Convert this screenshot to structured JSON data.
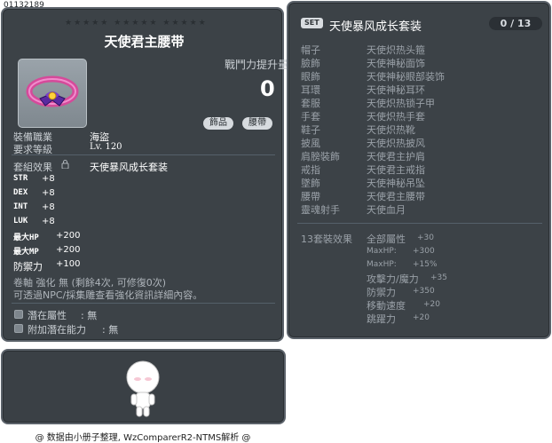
{
  "item": {
    "id_code": "01132189",
    "stars": "★★★★★  ★★★★★  ★★★★★",
    "name": "天使君主腰带",
    "damage_label": "戰鬥力提升量",
    "damage_value": "0",
    "categories": [
      "飾品",
      "腰帶"
    ],
    "job_label": "裝備職業",
    "job_value": "海盜",
    "level_label": "要求等級",
    "level_value": "Lv. 120",
    "set_label": "套組效果",
    "set_name": "天使暴风成长套装",
    "stats": [
      {
        "name": "STR",
        "value": "+8"
      },
      {
        "name": "DEX",
        "value": "+8"
      },
      {
        "name": "INT",
        "value": "+8"
      },
      {
        "name": "LUK",
        "value": "+8"
      },
      {
        "name": "最大HP",
        "value": "+200"
      },
      {
        "name": "最大MP",
        "value": "+200"
      },
      {
        "name": "防禦力",
        "value": "+100"
      }
    ],
    "upgrade_text": "卷軸 強化 無 (剩餘4次, 可修復0次)",
    "info_text": "可透過NPC/採集雕查看強化資訊詳細內容。",
    "potential_label": "潛在屬性",
    "potential_value": ": 無",
    "bonus_potential_label": "附加潛在能力",
    "bonus_potential_value": ": 無"
  },
  "set": {
    "badge": "SET",
    "title": "天使暴风成长套装",
    "count": "0 / 13",
    "items": [
      {
        "slot": "帽子",
        "name": "天使炽热头箍"
      },
      {
        "slot": "臉飾",
        "name": "天使神秘面饰"
      },
      {
        "slot": "眼飾",
        "name": "天使神秘眼部装饰"
      },
      {
        "slot": "耳環",
        "name": "天使神秘耳环"
      },
      {
        "slot": "套服",
        "name": "天使炽热锁子甲"
      },
      {
        "slot": "手套",
        "name": "天使炽热手套"
      },
      {
        "slot": "鞋子",
        "name": "天使炽热靴"
      },
      {
        "slot": "披風",
        "name": "天使炽热披风"
      },
      {
        "slot": "肩膀裝飾",
        "name": "天使君主护肩"
      },
      {
        "slot": "戒指",
        "name": "天使君主戒指"
      },
      {
        "slot": "墜飾",
        "name": "天使神秘吊坠"
      },
      {
        "slot": "腰帶",
        "name": "天使君主腰带"
      },
      {
        "slot": "靈魂射手",
        "name": "天使血月"
      }
    ],
    "bonus_label": "13套裝效果",
    "bonuses": [
      {
        "name": "全部屬性",
        "value": "+30"
      },
      {
        "name": "MaxHP:",
        "value": "+300"
      },
      {
        "name": "MaxHP:",
        "value": "+15%"
      },
      {
        "name": "攻擊力/魔力",
        "value": "+35"
      },
      {
        "name": "防禦力",
        "value": "+350"
      },
      {
        "name": "移動速度",
        "value": "+20"
      },
      {
        "name": "跳躍力",
        "value": "+20"
      }
    ]
  },
  "credit": "@ 数据由小册子整理, WzComparerR2-NTMS解析 @"
}
